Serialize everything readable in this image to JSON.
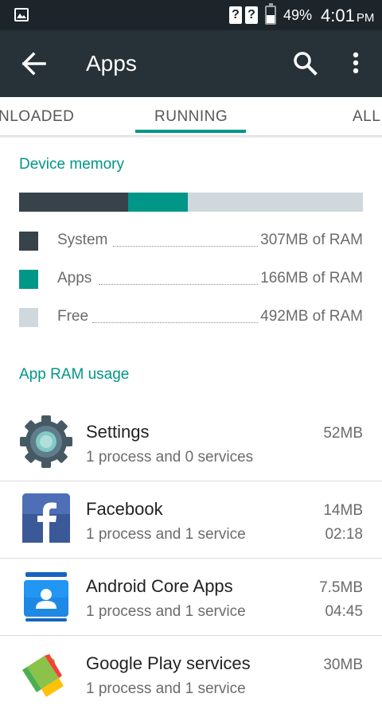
{
  "status_bar": {
    "battery_percent": "49%",
    "battery_level": 0.49,
    "time": "4:01",
    "ampm": "PM",
    "icons": [
      "gallery-icon",
      "unknown-sim-icon",
      "unknown-sim-icon",
      "battery-icon"
    ]
  },
  "app_bar": {
    "title": "Apps",
    "icons": [
      "back-arrow-icon",
      "search-icon",
      "more-vert-icon"
    ]
  },
  "tabs": [
    {
      "label": "DOWNLOADED",
      "visible_label": "NLOADED",
      "active": false
    },
    {
      "label": "RUNNING",
      "active": true
    },
    {
      "label": "ALL",
      "active": false
    }
  ],
  "device_memory": {
    "title": "Device memory",
    "shares": {
      "system": 307,
      "apps": 166,
      "free": 492
    },
    "legend": [
      {
        "label": "System",
        "value": "307MB of RAM",
        "color": "#37424a"
      },
      {
        "label": "Apps",
        "value": "166MB of RAM",
        "color": "#009688"
      },
      {
        "label": "Free",
        "value": "492MB of RAM",
        "color": "#cfd8dc"
      }
    ]
  },
  "app_ram": {
    "title": "App RAM usage",
    "apps": [
      {
        "name": "Settings",
        "sub": "1 process and 0 services",
        "size": "52MB",
        "duration": "",
        "icon": "settings-gear-icon"
      },
      {
        "name": "Facebook",
        "sub": "1 process and 1 service",
        "size": "14MB",
        "duration": "02:18",
        "icon": "facebook-icon"
      },
      {
        "name": "Android Core Apps",
        "sub": "1 process and 1 service",
        "size": "7.5MB",
        "duration": "04:45",
        "icon": "contacts-icon"
      },
      {
        "name": "Google Play services",
        "sub": "1 process and 1 service",
        "size": "30MB",
        "duration": "",
        "icon": "play-services-puzzle-icon"
      }
    ]
  },
  "colors": {
    "accent": "#009688",
    "app_bar": "#263238",
    "status_bar": "#1d252b"
  }
}
